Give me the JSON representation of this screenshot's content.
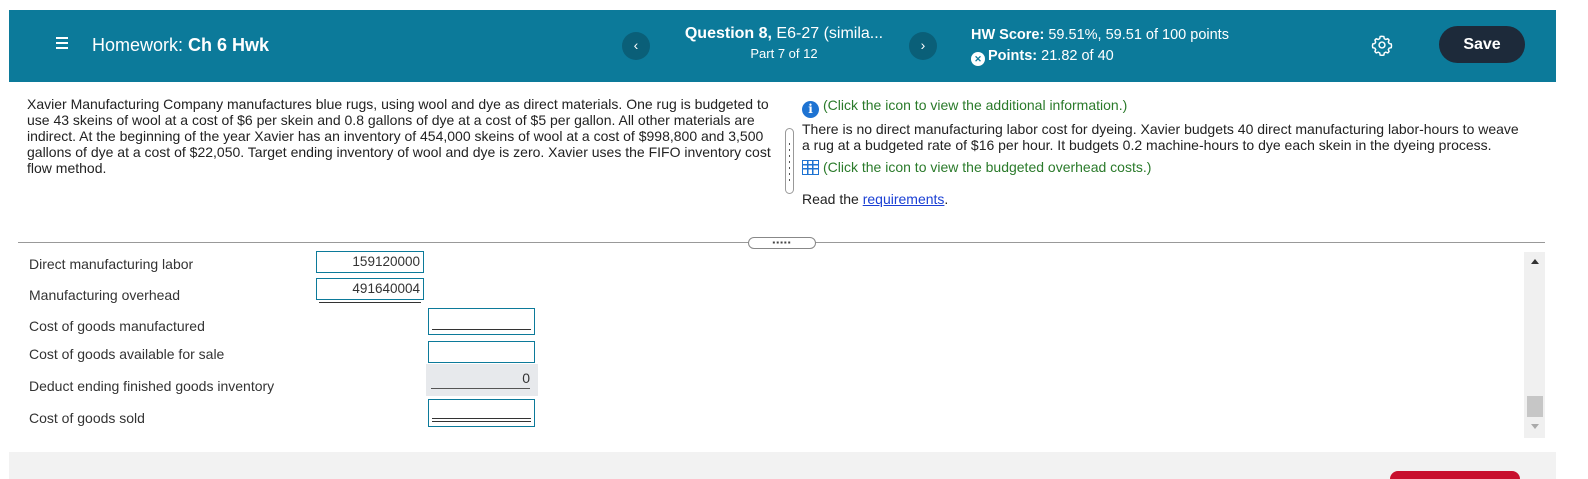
{
  "header": {
    "hw_prefix": "Homework:",
    "hw_name": "Ch 6 Hwk",
    "question_bold": "Question 8,",
    "question_rest": " E6-27 (simila...",
    "part": "Part 7 of 12",
    "prev_symbol": "‹",
    "next_symbol": "›",
    "score_label": "HW Score:",
    "score_value": " 59.51%, 59.51 of 100 points",
    "points_label": "Points:",
    "points_value": " 21.82 of 40",
    "save_label": "Save",
    "colors": {
      "bar": "#0c7a9a",
      "save": "#1d2a3a"
    }
  },
  "problem": {
    "text": "Xavier Manufacturing Company manufactures blue rugs, using wool and dye as direct materials. One rug is budgeted to use 43 skeins of wool at a cost of $6 per skein and 0.8 gallons of dye at a cost of $5 per gallon. All other materials are indirect. At the beginning of the year Xavier has an inventory of 454,000 skeins of wool at a cost of $998,800 and 3,500 gallons of dye at a cost of $22,050. Target ending inventory of wool and dye is zero. Xavier uses the FIFO inventory cost flow method."
  },
  "right": {
    "info_link": "(Click the icon to view the additional information.)",
    "info_text": "There is no direct manufacturing labor cost for dyeing. Xavier budgets 40 direct manufacturing labor-hours to weave a rug at a budgeted rate of $16 per hour. It budgets 0.2 machine-hours to dye each skein in the dyeing process.",
    "overhead_link": "(Click the icon to view the budgeted overhead costs.)",
    "read_prefix": "Read the ",
    "requirements_link": "requirements",
    "read_suffix": "."
  },
  "worksheet": {
    "direct_labor_label": "Direct manufacturing labor",
    "direct_labor_value": "159120000",
    "overhead_label": "Manufacturing overhead",
    "overhead_value": "491640004",
    "cogm_label": "Cost of goods manufactured",
    "cogas_label": "Cost of goods available for sale",
    "ending_fg_label": "Deduct ending finished goods inventory",
    "ending_fg_value": "0",
    "cogs_label": "Cost of goods sold"
  }
}
